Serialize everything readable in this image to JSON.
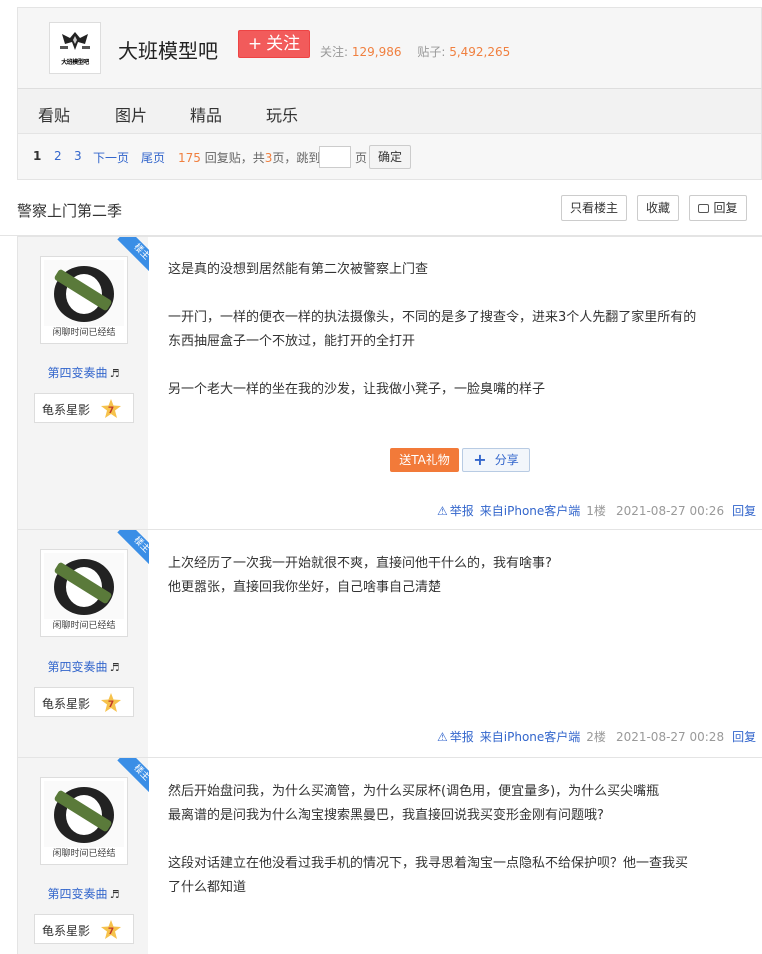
{
  "forum": {
    "logo_text": "大班模型吧",
    "name": "大班模型吧",
    "follow_label": "关注",
    "follow_prefix": "+",
    "followers_label": "关注:",
    "followers": "129,986",
    "posts_label": "贴子:",
    "posts": "5,492,265"
  },
  "nav": [
    "看贴",
    "图片",
    "精品",
    "玩乐"
  ],
  "pager": {
    "current": "1",
    "pages": [
      "2",
      "3"
    ],
    "next": "下一页",
    "last": "尾页",
    "reply_count": "175",
    "info_mid": "回复贴，共",
    "page_total": "3",
    "info_end": "页，跳到",
    "unit": "页",
    "ok": "确定"
  },
  "thread": {
    "title": "警察上门第二季",
    "only_op": "只看楼主",
    "favorite": "收藏",
    "reply": "回复"
  },
  "common": {
    "op_ribbon": "楼主",
    "avatar_caption": "闲聊时间已经结",
    "username": "第四变奏曲",
    "username_note": "♬",
    "badge_name": "龟系星影",
    "badge_level": "7",
    "colors": {
      "link": "#3366cc",
      "orange": "#f08040",
      "ribbon": "#3a8ee6",
      "follow": "#f25b5b"
    }
  },
  "posts": [
    {
      "lines": [
        "这是真的没想到居然能有第二次被警察上门查",
        "",
        "一开门，一样的便衣一样的执法摄像头，不同的是多了搜查令，进来3个人先翻了家里所有的",
        "东西抽屉盒子一个不放过，能打开的全打开",
        "",
        "另一个老大一样的坐在我的沙发，让我做小凳子，一脸臭嘴的样子"
      ],
      "gift": "送TA礼物",
      "share": "分享",
      "report": "举报",
      "source": "来自iPhone客户端",
      "floor": "1楼",
      "time": "2021-08-27 00:26",
      "reply": "回复"
    },
    {
      "lines": [
        "上次经历了一次我一开始就很不爽，直接问他干什么的，我有啥事?",
        "他更嚣张，直接回我你坐好，自己啥事自己清楚"
      ],
      "report": "举报",
      "source": "来自iPhone客户端",
      "floor": "2楼",
      "time": "2021-08-27 00:28",
      "reply": "回复"
    },
    {
      "lines": [
        "然后开始盘问我，为什么买滴管，为什么买尿杯(调色用，便宜量多)，为什么买尖嘴瓶",
        "最离谱的是问我为什么淘宝搜索黑曼巴，我直接回说我买变形金刚有问题哦?",
        "",
        "这段对话建立在他没看过我手机的情况下，我寻思着淘宝一点隐私不给保护呗？他一查我买",
        "了什么都知道"
      ]
    }
  ]
}
